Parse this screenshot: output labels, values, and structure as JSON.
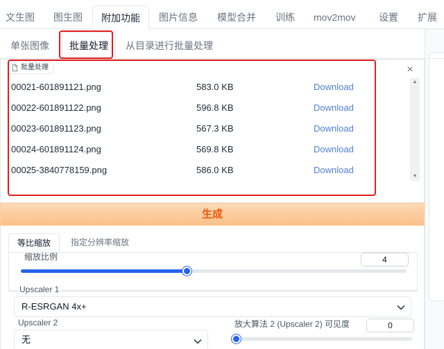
{
  "top_tabs": [
    "文生图",
    "图生图",
    "附加功能",
    "图片信息",
    "模型合并",
    "训练",
    "mov2mov",
    "设置",
    "扩展"
  ],
  "sub_tabs": [
    "单张图像",
    "批量处理",
    "从目录进行批量处理"
  ],
  "gallery": {
    "label": "批量处理",
    "files": [
      {
        "name": "00021-601891121.png",
        "size": "583.0 KB",
        "link": "Download"
      },
      {
        "name": "00022-601891122.png",
        "size": "596.8 KB",
        "link": "Download"
      },
      {
        "name": "00023-601891123.png",
        "size": "567.3 KB",
        "link": "Download"
      },
      {
        "name": "00024-601891124.png",
        "size": "569.8 KB",
        "link": "Download"
      },
      {
        "name": "00025-3840778159.png",
        "size": "586.0 KB",
        "link": "Download"
      }
    ]
  },
  "generate_label": "生成",
  "scale_tabs": [
    "等比缩放",
    "指定分辨率缩放"
  ],
  "resize": {
    "label": "缩放比例",
    "value": "4",
    "level_fraction": 0.43
  },
  "upscaler1": {
    "label": "Upscaler 1",
    "value": "R-ESRGAN 4x+"
  },
  "upscaler2": {
    "label": "Upscaler 2",
    "value": "无"
  },
  "visibility": {
    "label": "放大算法 2 (Upscaler 2) 可见度",
    "value": "0",
    "level_fraction": 0.0
  },
  "colors": {
    "accent": "#2563eb",
    "generate_text": "#ea580c",
    "highlight": "#e11d1d",
    "link": "#4f7fd9"
  }
}
